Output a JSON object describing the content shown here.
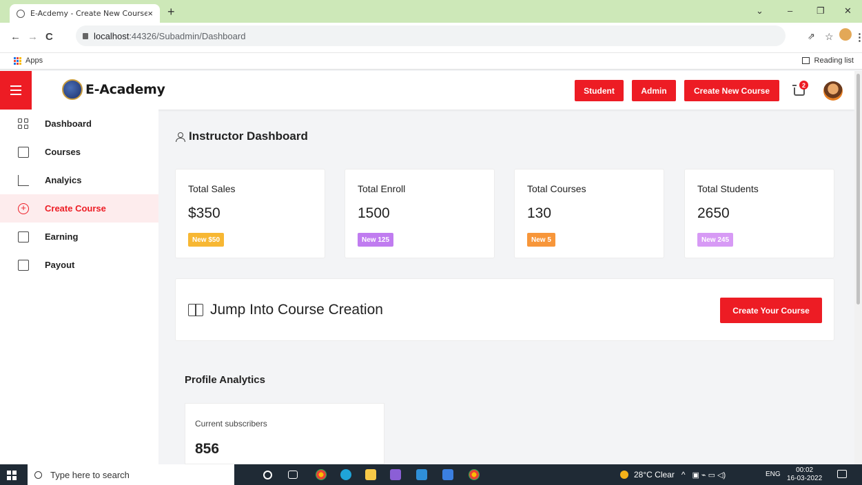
{
  "browser": {
    "tab_title": "E-Acdemy - Create New Course",
    "tab_close": "×",
    "new_tab": "+",
    "url_host": "localhost",
    "url_path": ":44326/Subadmin/Dashboard",
    "bookmarks_apps": "Apps",
    "reading_list": "Reading list"
  },
  "header": {
    "brand": "E-Academy",
    "buttons": [
      "Student",
      "Admin",
      "Create New Course"
    ],
    "cart_count": "2",
    "accent_color": "#ed1c24"
  },
  "sidebar": {
    "items": [
      {
        "label": "Dashboard",
        "icon": "grid-icon"
      },
      {
        "label": "Courses",
        "icon": "book-icon"
      },
      {
        "label": "Analyics",
        "icon": "chart-icon"
      },
      {
        "label": "Create Course",
        "icon": "plus-circle-icon",
        "active": true
      },
      {
        "label": "Earning",
        "icon": "folder-icon"
      },
      {
        "label": "Payout",
        "icon": "card-icon"
      }
    ]
  },
  "main": {
    "title": "Instructor Dashboard",
    "stats": [
      {
        "label": "Total Sales",
        "value": "$350",
        "badge": "New $50",
        "badge_color": "#f7b733"
      },
      {
        "label": "Total Enroll",
        "value": "1500",
        "badge": "New 125",
        "badge_color": "#c07cf0"
      },
      {
        "label": "Total Courses",
        "value": "130",
        "badge": "New 5",
        "badge_color": "#f7963a"
      },
      {
        "label": "Total Students",
        "value": "2650",
        "badge": "New 245",
        "badge_color": "#d79af5"
      }
    ],
    "jump": {
      "title": "Jump Into Course Creation",
      "button": "Create Your Course"
    },
    "profile_analytics": {
      "heading": "Profile Analytics",
      "subscribers_label": "Current subscribers",
      "subscribers_value": "856"
    }
  },
  "taskbar": {
    "search_placeholder": "Type here to search",
    "weather": "28°C  Clear",
    "lang": "ENG",
    "time": "00:02",
    "date": "16-03-2022"
  }
}
